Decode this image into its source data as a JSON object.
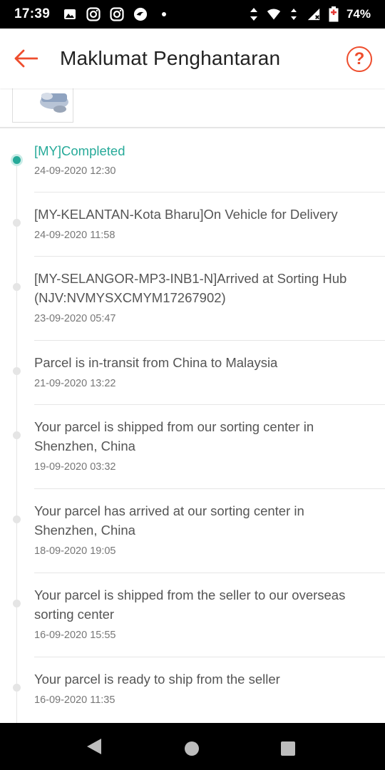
{
  "status_bar": {
    "time": "17:39",
    "battery": "74%",
    "icons": [
      "photo-icon",
      "instagram-icon",
      "instagram-icon",
      "chat-bubble-icon",
      "dot-icon",
      "data-arrows-icon",
      "wifi-icon",
      "signal-icon",
      "battery-icon"
    ]
  },
  "app_bar": {
    "title": "Maklumat Penghantaran",
    "help_symbol": "?",
    "accent_color": "#ee4d2d"
  },
  "timeline": {
    "active_color": "#26aa99",
    "events": [
      {
        "text": "[MY]Completed",
        "time": "24-09-2020 12:30",
        "active": true
      },
      {
        "text": "[MY-KELANTAN-Kota Bharu]On Vehicle for Delivery",
        "time": "24-09-2020 11:58",
        "active": false
      },
      {
        "text": "[MY-SELANGOR-MP3-INB1-N]Arrived at Sorting Hub (NJV:NVMYSXCMYM17267902)",
        "time": "23-09-2020 05:47",
        "active": false
      },
      {
        "text": "Parcel is in-transit from China to Malaysia",
        "time": "21-09-2020 13:22",
        "active": false
      },
      {
        "text": "Your parcel is shipped from our sorting center in Shenzhen, China",
        "time": "19-09-2020 03:32",
        "active": false
      },
      {
        "text": "Your parcel has arrived at our sorting center in Shenzhen, China",
        "time": "18-09-2020 19:05",
        "active": false
      },
      {
        "text": "Your parcel is shipped from the seller to our overseas sorting center",
        "time": "16-09-2020 15:55",
        "active": false
      },
      {
        "text": "Your parcel is ready to ship from the seller",
        "time": "16-09-2020 11:35",
        "active": false
      }
    ]
  }
}
